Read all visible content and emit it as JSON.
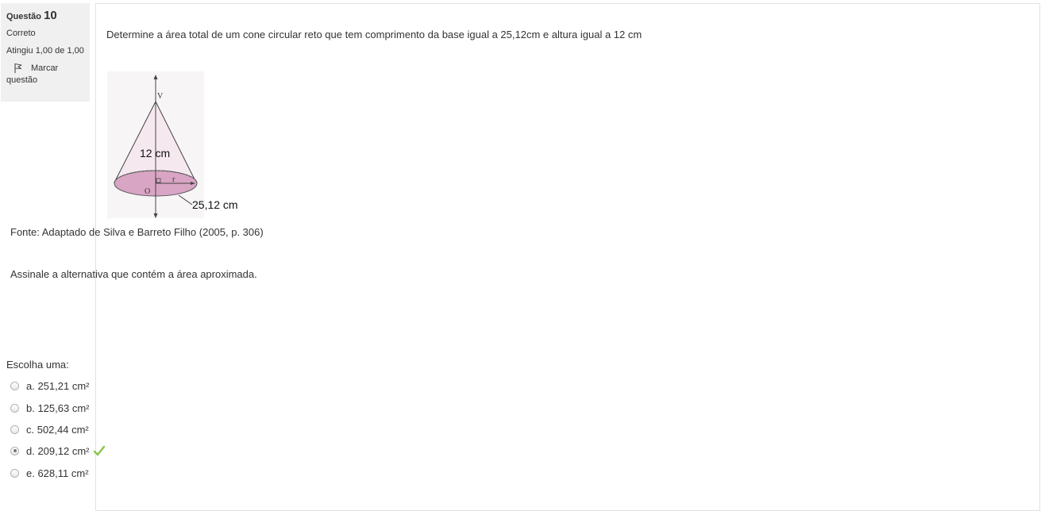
{
  "info": {
    "question_label": "Questão",
    "question_number": "10",
    "state": "Correto",
    "grade": "Atingiu 1,00 de 1,00",
    "flag_label_line1": "Marcar",
    "flag_label_line2": "questão",
    "flag_icon": "flag-icon"
  },
  "question": {
    "text": "Determine a área total de um cone circular reto que tem comprimento da base igual a 25,12cm e altura igual a 12 cm",
    "figure": {
      "vertex_label": "V",
      "height_label": "12 cm",
      "center_label": "O",
      "radius_label": "r",
      "base_label": "25,12 cm"
    },
    "source": "Fonte: Adaptado de Silva e Barreto Filho (2005, p. 306)",
    "instruction": "Assinale a alternativa que contém a área aproximada."
  },
  "answer": {
    "prompt": "Escolha uma:",
    "options": [
      {
        "label": "a. 251,21 cm²",
        "selected": false
      },
      {
        "label": "b. 125,63 cm²",
        "selected": false
      },
      {
        "label": "c. 502,44 cm²",
        "selected": false
      },
      {
        "label": "d. 209,12 cm²",
        "selected": true,
        "correct_icon": "check-icon"
      },
      {
        "label": "e. 628,11 cm²",
        "selected": false
      }
    ],
    "correct_color": "#8bc34a"
  }
}
